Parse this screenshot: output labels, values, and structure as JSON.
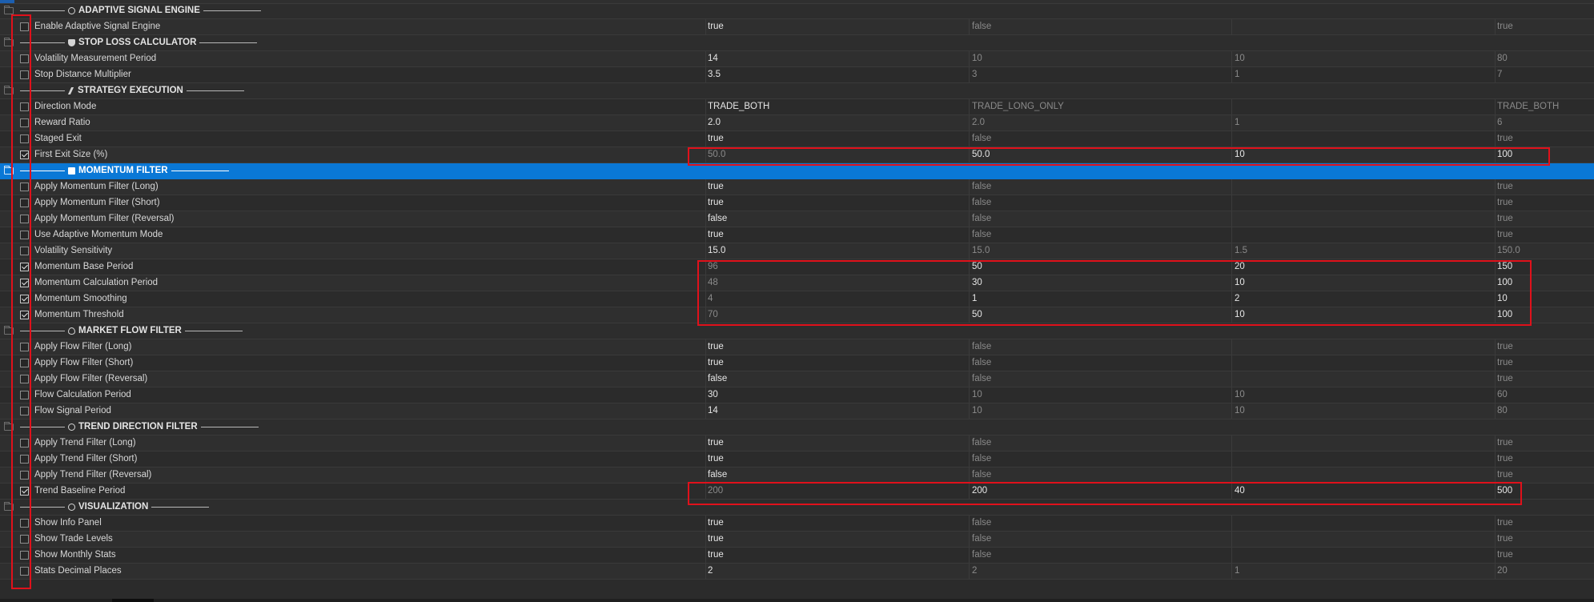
{
  "rows": [
    {
      "type": "section",
      "icon": "gear-icon",
      "title": "ADAPTIVE SIGNAL ENGINE"
    },
    {
      "type": "param",
      "name": "Enable Adaptive Signal Engine",
      "checked": false,
      "value": "true",
      "start": "false",
      "step": "",
      "stop": "true"
    },
    {
      "type": "section",
      "icon": "shield-icon",
      "title": "STOP LOSS CALCULATOR"
    },
    {
      "type": "param",
      "name": "Volatility Measurement Period",
      "checked": false,
      "value": "14",
      "start": "10",
      "step": "10",
      "stop": "80"
    },
    {
      "type": "param",
      "name": "Stop Distance Multiplier",
      "checked": false,
      "value": "3.5",
      "start": "3",
      "step": "1",
      "stop": "7"
    },
    {
      "type": "section",
      "icon": "bolt-icon",
      "title": "STRATEGY EXECUTION"
    },
    {
      "type": "param",
      "name": "Direction Mode",
      "checked": false,
      "value": "TRADE_BOTH",
      "start": "TRADE_LONG_ONLY",
      "step": "",
      "stop": "TRADE_BOTH"
    },
    {
      "type": "param",
      "name": "Reward Ratio",
      "checked": false,
      "value": "2.0",
      "start": "2.0",
      "step": "1",
      "stop": "6"
    },
    {
      "type": "param",
      "name": "Staged Exit",
      "checked": false,
      "value": "true",
      "start": "false",
      "step": "",
      "stop": "true"
    },
    {
      "type": "param",
      "name": "First Exit Size (%)",
      "checked": true,
      "value": "50.0",
      "start": "50.0",
      "step": "10",
      "stop": "100"
    },
    {
      "type": "section",
      "icon": "chart-box-icon",
      "title": "MOMENTUM FILTER",
      "selected": true
    },
    {
      "type": "param",
      "name": "Apply Momentum Filter (Long)",
      "checked": false,
      "value": "true",
      "start": "false",
      "step": "",
      "stop": "true"
    },
    {
      "type": "param",
      "name": "Apply Momentum Filter (Short)",
      "checked": false,
      "value": "true",
      "start": "false",
      "step": "",
      "stop": "true"
    },
    {
      "type": "param",
      "name": "Apply Momentum Filter (Reversal)",
      "checked": false,
      "value": "false",
      "start": "false",
      "step": "",
      "stop": "true"
    },
    {
      "type": "param",
      "name": "Use Adaptive Momentum Mode",
      "checked": false,
      "value": "true",
      "start": "false",
      "step": "",
      "stop": "true"
    },
    {
      "type": "param",
      "name": "Volatility Sensitivity",
      "checked": false,
      "value": "15.0",
      "start": "15.0",
      "step": "1.5",
      "stop": "150.0"
    },
    {
      "type": "param",
      "name": "Momentum Base Period",
      "checked": true,
      "value": "96",
      "start": "50",
      "step": "20",
      "stop": "150"
    },
    {
      "type": "param",
      "name": "Momentum Calculation Period",
      "checked": true,
      "value": "48",
      "start": "30",
      "step": "10",
      "stop": "100"
    },
    {
      "type": "param",
      "name": "Momentum Smoothing",
      "checked": true,
      "value": "4",
      "start": "1",
      "step": "2",
      "stop": "10"
    },
    {
      "type": "param",
      "name": "Momentum Threshold",
      "checked": true,
      "value": "70",
      "start": "50",
      "step": "10",
      "stop": "100"
    },
    {
      "type": "section",
      "icon": "drop-icon",
      "title": "MARKET FLOW FILTER"
    },
    {
      "type": "param",
      "name": "Apply Flow Filter (Long)",
      "checked": false,
      "value": "true",
      "start": "false",
      "step": "",
      "stop": "true"
    },
    {
      "type": "param",
      "name": "Apply Flow Filter (Short)",
      "checked": false,
      "value": "true",
      "start": "false",
      "step": "",
      "stop": "true"
    },
    {
      "type": "param",
      "name": "Apply Flow Filter (Reversal)",
      "checked": false,
      "value": "false",
      "start": "false",
      "step": "",
      "stop": "true"
    },
    {
      "type": "param",
      "name": "Flow Calculation Period",
      "checked": false,
      "value": "30",
      "start": "10",
      "step": "10",
      "stop": "60"
    },
    {
      "type": "param",
      "name": "Flow Signal Period",
      "checked": false,
      "value": "14",
      "start": "10",
      "step": "10",
      "stop": "80"
    },
    {
      "type": "section",
      "icon": "compass-icon",
      "title": "TREND DIRECTION FILTER"
    },
    {
      "type": "param",
      "name": "Apply Trend Filter (Long)",
      "checked": false,
      "value": "true",
      "start": "false",
      "step": "",
      "stop": "true"
    },
    {
      "type": "param",
      "name": "Apply Trend Filter (Short)",
      "checked": false,
      "value": "true",
      "start": "false",
      "step": "",
      "stop": "true"
    },
    {
      "type": "param",
      "name": "Apply Trend Filter (Reversal)",
      "checked": false,
      "value": "false",
      "start": "false",
      "step": "",
      "stop": "true"
    },
    {
      "type": "param",
      "name": "Trend Baseline Period",
      "checked": true,
      "value": "200",
      "start": "200",
      "step": "40",
      "stop": "500"
    },
    {
      "type": "section",
      "icon": "eye-icon",
      "title": "VISUALIZATION"
    },
    {
      "type": "param",
      "name": "Show Info Panel",
      "checked": false,
      "value": "true",
      "start": "false",
      "step": "",
      "stop": "true"
    },
    {
      "type": "param",
      "name": "Show Trade Levels",
      "checked": false,
      "value": "true",
      "start": "false",
      "step": "",
      "stop": "true"
    },
    {
      "type": "param",
      "name": "Show Monthly Stats",
      "checked": false,
      "value": "true",
      "start": "false",
      "step": "",
      "stop": "true"
    },
    {
      "type": "param",
      "name": "Stats Decimal Places",
      "checked": false,
      "value": "2",
      "start": "2",
      "step": "1",
      "stop": "20"
    }
  ],
  "colors": {
    "background": "#2b2b2b",
    "selected_row": "#0a78d6",
    "highlight_box": "#e0111b",
    "text": "#d8d8d8",
    "dim_text": "#8a8a8a"
  }
}
